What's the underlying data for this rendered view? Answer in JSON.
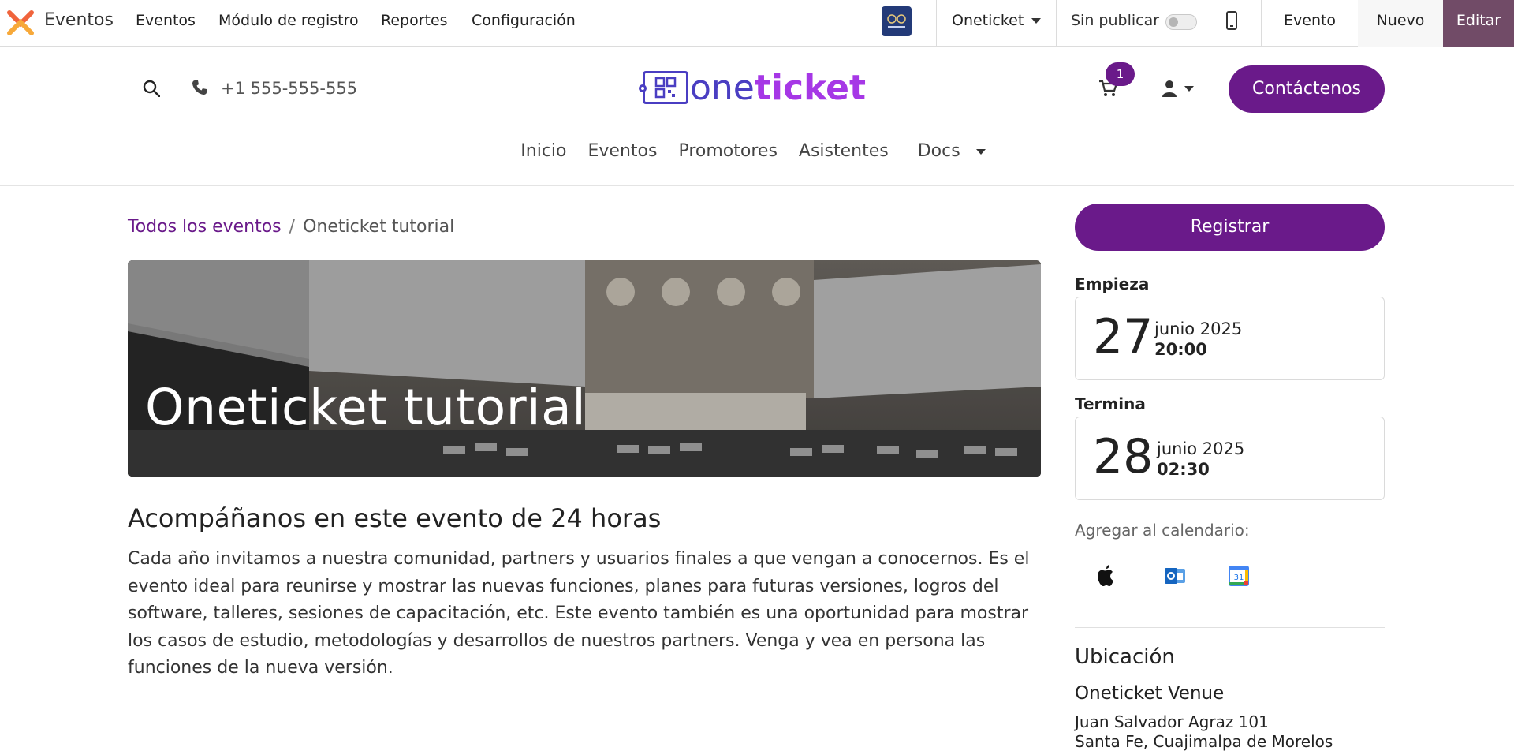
{
  "adminbar": {
    "app_name": "Eventos",
    "menu": [
      "Eventos",
      "Módulo de registro",
      "Reportes",
      "Configuración"
    ],
    "website": "Oneticket",
    "publish_label": "Sin publicar",
    "evento_label": "Evento",
    "nuevo_label": "Nuevo",
    "editar_label": "Editar",
    "icons": {
      "logo": "odoo-app-logo-icon",
      "phone": "mobile-preview-icon"
    }
  },
  "header": {
    "phone": "+1 555-555-555",
    "logo_one": "one",
    "logo_ticket": "ticket",
    "cart_count": "1",
    "contact_label": "Contáctenos",
    "nav": [
      "Inicio",
      "Eventos",
      "Promotores",
      "Asistentes",
      "Docs"
    ],
    "colors": {
      "primary": "#6a1a8a",
      "logo_blue": "#4a3ec2",
      "logo_purple": "#a637e6",
      "admin_accent": "#714b67"
    }
  },
  "breadcrumb": {
    "parent": "Todos los eventos",
    "current": "Oneticket tutorial"
  },
  "event": {
    "title": "Oneticket tutorial",
    "subtitle": "Acompáñanos en este evento de 24 horas",
    "description": "Cada año invitamos a nuestra comunidad, partners y usuarios finales a que vengan a conocernos. Es el evento ideal para reunirse y mostrar las nuevas funciones, planes para futuras versiones, logros del software, talleres, sesiones de capacitación, etc. Este evento también es una oportunidad para mostrar los casos de estudio, metodologías y desarrollos de nuestros partners. Venga y vea en persona las funciones de la nueva versión."
  },
  "sidebar": {
    "register_label": "Registrar",
    "start_label": "Empieza",
    "start_day": "27",
    "start_month": "junio 2025",
    "start_time": "20:00",
    "end_label": "Termina",
    "end_day": "28",
    "end_month": "junio 2025",
    "end_time": "02:30",
    "calendar_label": "Agregar al calendario:",
    "calendar_icons": [
      "apple-calendar-icon",
      "outlook-calendar-icon",
      "google-calendar-icon"
    ],
    "google_cal_day": "31",
    "location_title": "Ubicación",
    "venue": "Oneticket Venue",
    "address_line1": "Juan Salvador Agraz 101",
    "address_line2": "Santa Fe, Cuajimalpa de Morelos"
  }
}
